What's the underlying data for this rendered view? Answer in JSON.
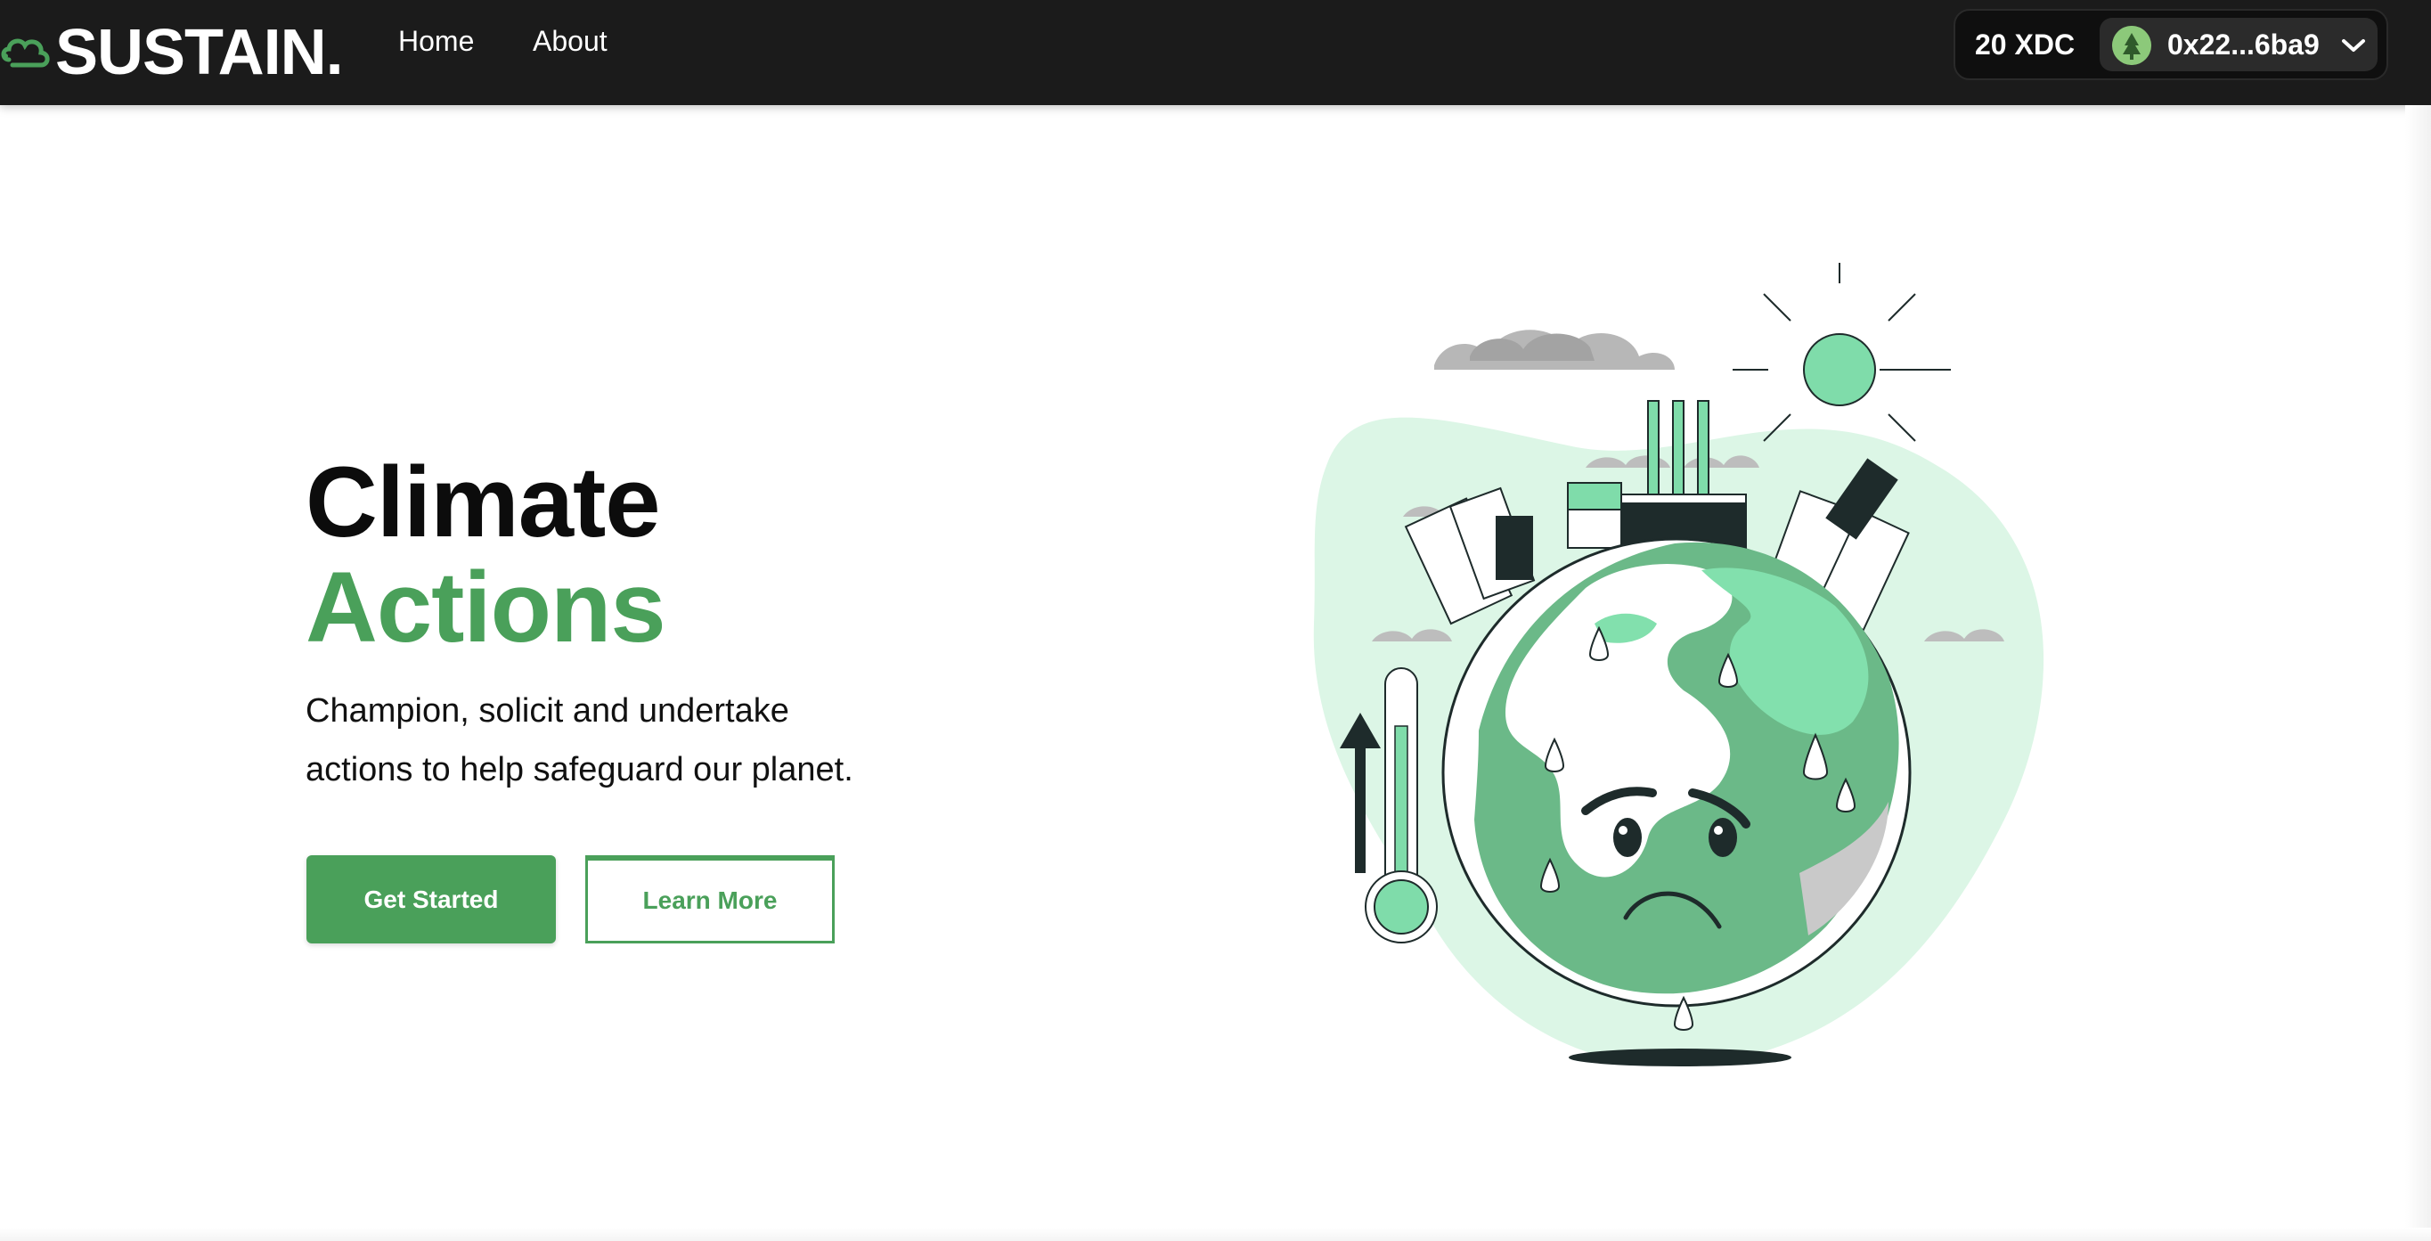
{
  "app": {
    "logo_text": "SUSTAIN.",
    "nav": [
      {
        "label": "Home"
      },
      {
        "label": "About"
      }
    ]
  },
  "wallet": {
    "balance": "20 XDC",
    "account": "0x22...6ba9"
  },
  "hero": {
    "title_line1": "Climate",
    "title_line2": "Actions",
    "subtitle_line1": "Champion, solicit and undertake",
    "subtitle_line2": "actions to help safeguard our planet.",
    "primary_button": "Get Started",
    "secondary_button": "Learn More"
  },
  "colors": {
    "navbar": "#1b1b1b",
    "brand_green": "#4aa05a",
    "globe_green": "#7fdcaa"
  },
  "icons": {
    "logo": "cloud-leaf-icon",
    "avatar": "tree-avatar-icon",
    "dropdown": "chevron-down-icon"
  }
}
